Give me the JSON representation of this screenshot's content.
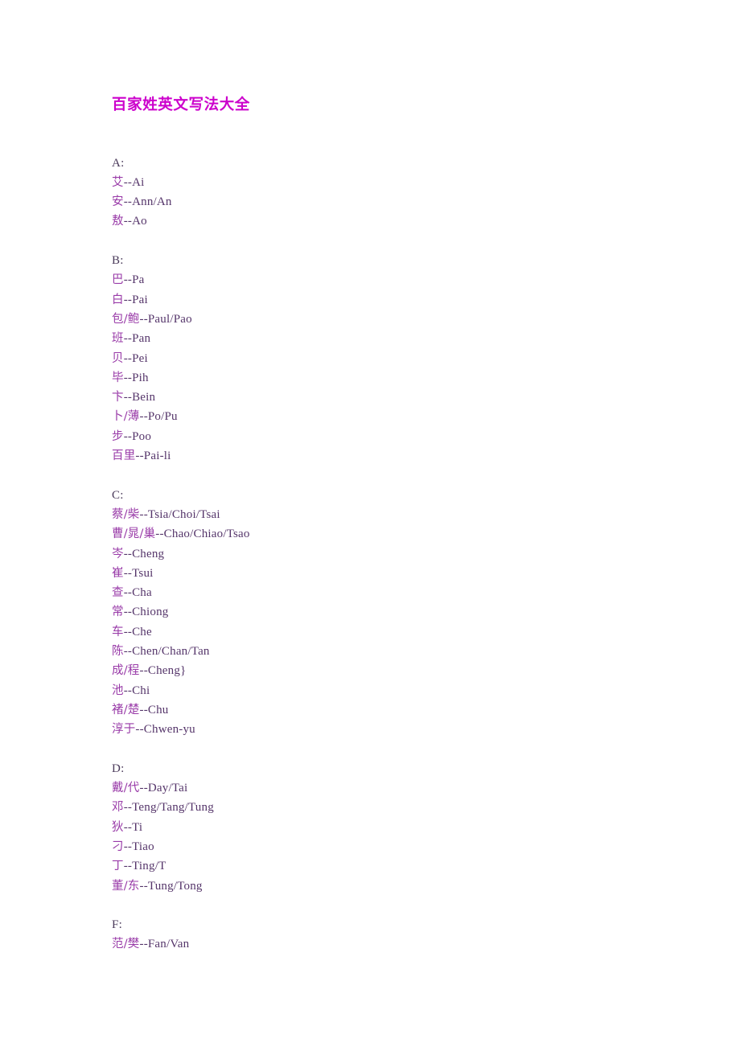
{
  "document": {
    "title": "百家姓英文写法大全",
    "title_color": "#cc00cc",
    "body_color": "#55356a",
    "han_color": "#993ba8",
    "background_color": "#ffffff"
  },
  "sections": [
    {
      "letter": "A:",
      "entries": [
        {
          "han": "艾",
          "sep": "--",
          "rom": "Ai",
          "full": "艾--Ai"
        },
        {
          "han": "安",
          "sep": "--",
          "rom": "Ann/An",
          "full": "安--Ann/An"
        },
        {
          "han": "敖",
          "sep": "--",
          "rom": "Ao",
          "full": "敖--Ao"
        }
      ]
    },
    {
      "letter": "B:",
      "entries": [
        {
          "han": "巴",
          "sep": "--",
          "rom": "Pa",
          "full": "巴--Pa"
        },
        {
          "han": "白",
          "sep": "--",
          "rom": "Pai",
          "full": "白--Pai"
        },
        {
          "han": "包/鲍",
          "sep": "--",
          "rom": "Paul/Pao",
          "full": "包/鲍--Paul/Pao"
        },
        {
          "han": "班",
          "sep": "--",
          "rom": "Pan",
          "full": "班--Pan"
        },
        {
          "han": "贝",
          "sep": "--",
          "rom": "Pei",
          "full": "贝--Pei"
        },
        {
          "han": "毕",
          "sep": "--",
          "rom": "Pih",
          "full": "毕--Pih"
        },
        {
          "han": "卞",
          "sep": "--",
          "rom": "Bein",
          "full": "卞--Bein"
        },
        {
          "han": "卜/薄",
          "sep": "--",
          "rom": "Po/Pu",
          "full": "卜/薄--Po/Pu"
        },
        {
          "han": "步",
          "sep": "--",
          "rom": "Poo",
          "full": "步--Poo"
        },
        {
          "han": "百里",
          "sep": "--",
          "rom": "Pai-li",
          "full": "百里--Pai-li"
        }
      ]
    },
    {
      "letter": "C:",
      "entries": [
        {
          "han": "蔡/柴",
          "sep": "--",
          "rom": "Tsia/Choi/Tsai",
          "full": "蔡/柴--Tsia/Choi/Tsai"
        },
        {
          "han": "曹/晁/巢",
          "sep": "--",
          "rom": "Chao/Chiao/Tsao",
          "full": "曹/晁/巢--Chao/Chiao/Tsao"
        },
        {
          "han": "岑",
          "sep": "--",
          "rom": "Cheng",
          "full": "岑--Cheng"
        },
        {
          "han": "崔",
          "sep": "--",
          "rom": "Tsui",
          "full": "崔--Tsui"
        },
        {
          "han": "查",
          "sep": "--",
          "rom": "Cha",
          "full": "查--Cha"
        },
        {
          "han": "常",
          "sep": "--",
          "rom": "Chiong",
          "full": "常--Chiong"
        },
        {
          "han": "车",
          "sep": "--",
          "rom": "Che",
          "full": "车--Che"
        },
        {
          "han": "陈",
          "sep": "--",
          "rom": "Chen/Chan/Tan",
          "full": "陈--Chen/Chan/Tan"
        },
        {
          "han": "成/程",
          "sep": "--",
          "rom": "Cheng}",
          "full": "成/程--Cheng}"
        },
        {
          "han": "池",
          "sep": "--",
          "rom": "Chi",
          "full": "池--Chi"
        },
        {
          "han": "褚/楚",
          "sep": "--",
          "rom": "Chu",
          "full": "褚/楚--Chu"
        },
        {
          "han": "淳于",
          "sep": "--",
          "rom": "Chwen-yu",
          "full": "淳于--Chwen-yu"
        }
      ]
    },
    {
      "letter": "D:",
      "entries": [
        {
          "han": "戴/代",
          "sep": "--",
          "rom": "Day/Tai",
          "full": "戴/代--Day/Tai"
        },
        {
          "han": "邓",
          "sep": "--",
          "rom": "Teng/Tang/Tung",
          "full": "邓--Teng/Tang/Tung"
        },
        {
          "han": "狄",
          "sep": "--",
          "rom": "Ti",
          "full": "狄--Ti"
        },
        {
          "han": "刁",
          "sep": "--",
          "rom": "Tiao",
          "full": "刁--Tiao"
        },
        {
          "han": "丁",
          "sep": "--",
          "rom": "Ting/T",
          "full": "丁--Ting/T"
        },
        {
          "han": "董/东",
          "sep": "--",
          "rom": "Tung/Tong",
          "full": "董/东--Tung/Tong"
        }
      ]
    },
    {
      "letter": "F:",
      "entries": [
        {
          "han": "范/樊",
          "sep": "--",
          "rom": "Fan/Van",
          "full": "范/樊--Fan/Van"
        }
      ]
    }
  ]
}
